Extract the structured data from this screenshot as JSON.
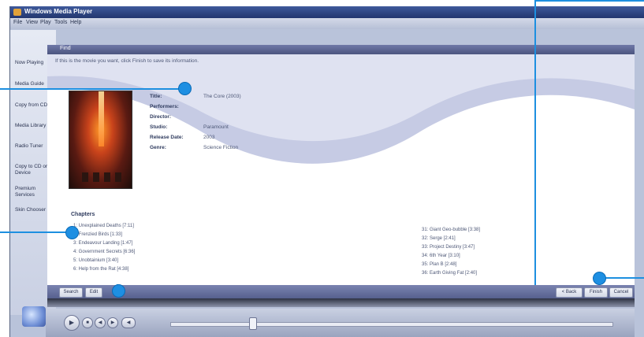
{
  "window": {
    "title": "Windows Media Player"
  },
  "menu": [
    "File",
    "View",
    "Play",
    "Tools",
    "Help"
  ],
  "sidebar": {
    "items": [
      {
        "label": "Now Playing",
        "arrow": "›"
      },
      {
        "label": "Media Guide",
        "arrow": ""
      },
      {
        "label": "Copy from CD",
        "arrow": ""
      },
      {
        "label": "Media Library",
        "arrow": ""
      },
      {
        "label": "Radio Tuner",
        "arrow": ""
      },
      {
        "label": "Copy to CD or Device",
        "arrow": ""
      },
      {
        "label": "Premium Services",
        "arrow": "›"
      },
      {
        "label": "Skin Chooser",
        "arrow": ""
      }
    ]
  },
  "info": {
    "header": "Find",
    "instruction": "If this is the movie you want, click Finish to save its information.",
    "fields": [
      {
        "label": "Title:",
        "value": "The Core (2003)"
      },
      {
        "label": "Performers:",
        "value": ""
      },
      {
        "label": "Director:",
        "value": ""
      },
      {
        "label": "Studio:",
        "value": "Paramount"
      },
      {
        "label": "Release Date:",
        "value": "2003"
      },
      {
        "label": "Genre:",
        "value": "Science Fiction"
      }
    ]
  },
  "chapters": {
    "title": "Chapters",
    "left": [
      "1:  Unexplained Deaths [7:11]",
      "2:  Frenzied Birds [1:33]",
      "3:  Endeavour Landing [1:47]",
      "4:  Government Secrets [6:36]",
      "5:  Unobtainium [3:40]",
      "6:  Help from the Rat [4:38]"
    ],
    "right": [
      "31:  Giant Geo-bubble [3:38]",
      "32:  Serge [2:41]",
      "33:  Project Destiny [3:47]",
      "34:  6th Year [3:10]",
      "35:  Plan B [2:48]",
      "36:  Earth Giving Fat [2:40]"
    ]
  },
  "buttons": {
    "search": "Search",
    "edit": "Edit",
    "back": "< Back",
    "finish": "Finish",
    "cancel": "Cancel"
  },
  "colors": {
    "accent": "#1e8fe2",
    "header": "#56608e"
  }
}
